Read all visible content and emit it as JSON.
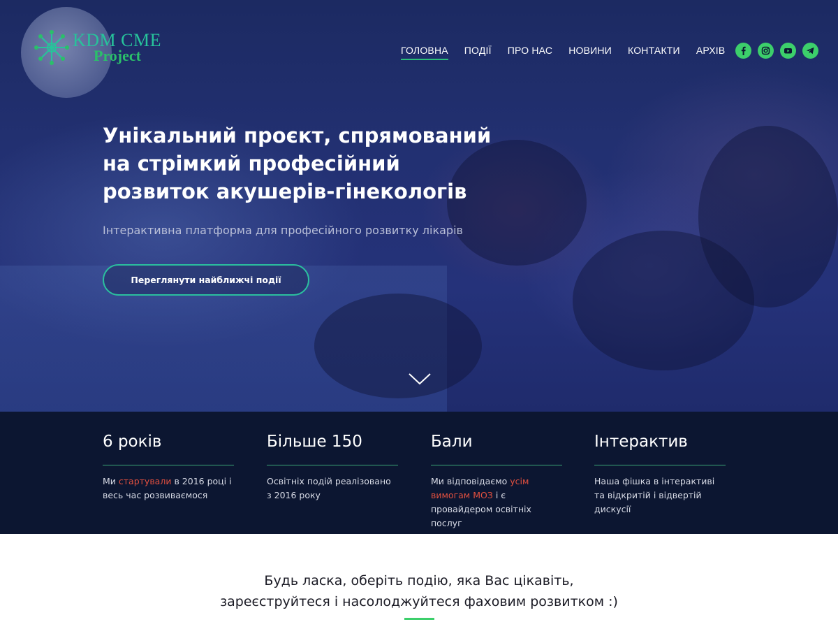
{
  "logo": {
    "title": "KDM CME",
    "subtitle": "Project"
  },
  "nav": {
    "items": [
      {
        "label": "ГОЛОВНА",
        "active": true
      },
      {
        "label": "ПОДІЇ"
      },
      {
        "label": "ПРО НАС"
      },
      {
        "label": "НОВИНИ"
      },
      {
        "label": "КОНТАКТИ"
      },
      {
        "label": "АРХІВ"
      }
    ]
  },
  "social": [
    "facebook-icon",
    "instagram-icon",
    "youtube-icon",
    "telegram-icon"
  ],
  "hero": {
    "title_line1": "Унікальний проєкт, спрямований",
    "title_line2": "на стрімкий професійний",
    "title_line3": "розвиток акушерів-гінекологів",
    "subtitle": "Інтерактивна платформа для професійного розвитку лікарів",
    "button": "Переглянути найближчі події"
  },
  "stats": [
    {
      "title": "6 років",
      "text_a": "Ми ",
      "text_hl": "стартували",
      "text_b": " в 2016 році і весь час розвиваємося"
    },
    {
      "title": "Більше 150",
      "text_a": "Освітніх подій реалізовано з 2016 року",
      "text_hl": "",
      "text_b": ""
    },
    {
      "title": "Бали",
      "text_a": "Ми відповідаємо ",
      "text_hl": "усім вимогам МОЗ",
      "text_b": " і є провайдером освітніх послуг"
    },
    {
      "title": "Інтерактив",
      "text_a": "Наша фішка в інтерактиві та відкритій і відвертій дискусії",
      "text_hl": "",
      "text_b": ""
    }
  ],
  "bottom": {
    "line1": "Будь ласка, оберіть подію, яка Вас цікавіть,",
    "line2": "зареєструйтеся і насолоджуйтеся фаховим розвитком :)"
  },
  "colors": {
    "accent_green": "#3ccf6b",
    "highlight_red": "#e2503f",
    "stats_bg": "#0c1631"
  }
}
